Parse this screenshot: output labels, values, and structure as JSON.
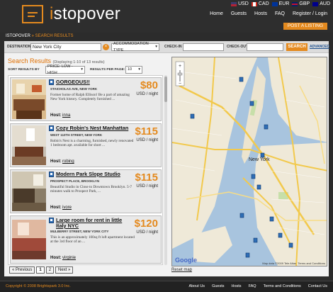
{
  "header": {
    "logo_text_prefix": "i",
    "logo_text_rest": "stopover",
    "currencies": [
      {
        "code": "USD",
        "flag_colors": [
          "#b22234",
          "#3c3b6e"
        ]
      },
      {
        "code": "CAD",
        "flag_colors": [
          "#d52b1e",
          "#ffffff"
        ]
      },
      {
        "code": "EUR",
        "flag_colors": [
          "#003399",
          "#ffcc00"
        ]
      },
      {
        "code": "GBP",
        "flag_colors": [
          "#012169",
          "#c8102e"
        ]
      },
      {
        "code": "AUD",
        "flag_colors": [
          "#00008b",
          "#ff0000"
        ]
      }
    ],
    "nav": [
      "Home",
      "Guests",
      "Hosts",
      "FAQ",
      "Register / Login"
    ],
    "post_listing": "POST A LISTING"
  },
  "breadcrumb": {
    "root": "ISTOPOVER",
    "separator": "»",
    "current": "SEARCH RESULTS"
  },
  "search": {
    "destination_label": "DESTINATION",
    "destination_value": "New York City",
    "clear_symbol": "×",
    "accommodation_label": "ACCOMMODATION TYPE",
    "checkin_label": "CHECK-IN",
    "checkout_label": "CHECK-OUT",
    "search_button": "SEARCH",
    "advanced_link": "ADVANCED"
  },
  "results": {
    "title": "Search Results",
    "subtitle": "(Displaying 1-10 of 13 results)",
    "sort_label": "SORT RESULTS BY",
    "sort_value": "PRICE: LOW - HIGH",
    "per_page_label": "RESULTS PER PAGE:",
    "per_page_value": "10",
    "listings": [
      {
        "title": "GORGEOUS!!",
        "address": "STAICHOLAS AVE, NEW YORK",
        "description": "Former home of Ralph Ellison! Be a part of amazing New York history. Completely furnished ...",
        "host_label": "Host:",
        "host": "inna",
        "price": "$80",
        "per": "USD / night"
      },
      {
        "title": "Cozy Robin's Nest Manhattan",
        "address": "WEST 110TH STREET, NEW YORK",
        "description": "Robin's Nest is a charming, furnished, newly renovated 1 bedroom apt. available for short ...",
        "host_label": "Host:",
        "host": "robing",
        "price": "$115",
        "per": "USD / night"
      },
      {
        "title": "Modern Park Slope Studio",
        "address": "PROSPECT PLACE, BROOKLYN",
        "description": "Beautiful Studio in Close to Downtown Brooklyn. 5-7 minutes walk to Prospect Park, ...",
        "host_label": "Host:",
        "host": "ivore",
        "price": "$115",
        "per": "USD / night"
      },
      {
        "title": "Large room for rent in little Italy NYC",
        "address": "MULBERRY STREET, NEW YORK CITY",
        "description": "This is an approximately 100sq ft loft apartment located at the 3rd floor of an ...",
        "host_label": "Host:",
        "host": "virginie",
        "price": "$120",
        "per": "USD / night"
      }
    ],
    "pager": [
      "« Previous",
      "1",
      "2",
      "Next »"
    ]
  },
  "map": {
    "reset_label": "Reset map",
    "credit": "Map data ©2009 Tele Atlas",
    "terms": "Terms and Conditions",
    "google_label": "Google",
    "city_labels": [
      "New York"
    ],
    "colors": {
      "water": "#a8c4de",
      "land": "#efe9d8",
      "highway": "#f2c94c",
      "marker": "#2e6db5"
    }
  },
  "footer": {
    "copyright": "Copyright © 2008 Brightspark 3.0 Inc.",
    "links": [
      "About Us",
      "Guests",
      "Hosts",
      "FAQ",
      "Terms and Conditions",
      "Contact Us"
    ]
  }
}
